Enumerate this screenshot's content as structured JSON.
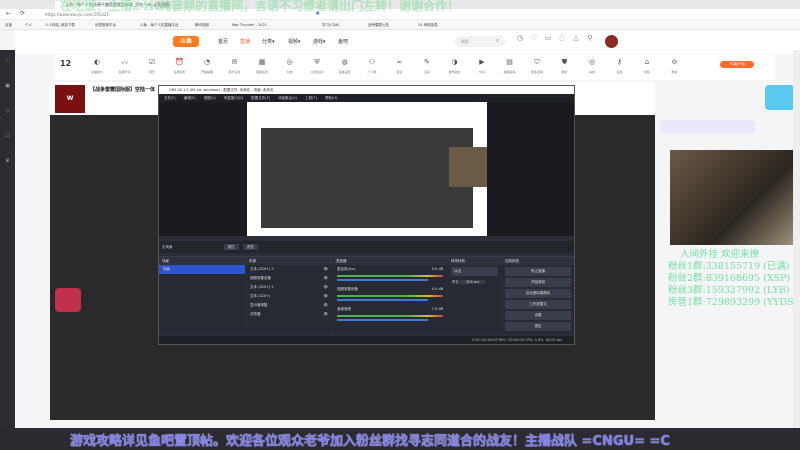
{
  "browser": {
    "tabs": [
      "斗鱼 - 每个人的直播平台",
      "战争雷霆国际服_空陆一体_斗鱼直播"
    ],
    "url": "https://www.douyu.com/201321",
    "bookmarks": [
      "百度",
      "个人",
      "人人网站_网游下载",
      "优秀推荐平台",
      "斗鱼 - 每个人的直播平台",
      "腾讯视频",
      "War Thunder - 2021",
      "学习(CDN)",
      "战争雷霆公告",
      "24 网络信息"
    ]
  },
  "overlay_top": "在吃饭：主播24K纯音频的直播间，言语不习惯者请出门左转！谢谢合作！",
  "site": {
    "logo": "斗鱼",
    "nav": [
      "首页",
      "直播",
      "分类▾",
      "视频▾",
      "游戏▾",
      "鱼吧"
    ],
    "search_placeholder": "搜索",
    "header_icons": [
      "历史",
      "关注",
      "下载",
      "客户端",
      "消息",
      "创作中心"
    ],
    "sidebar": [
      "推荐",
      "关注",
      "游戏",
      "娱乐",
      "更多"
    ],
    "toolbar": {
      "level": "12",
      "items": [
        "主播积分",
        "直播开关",
        "音乐",
        "主播任务",
        "开播提醒",
        "用户任务",
        "宝箱任务",
        "礼物",
        "礼物活动",
        "直播设置",
        "小飞机",
        "连麦",
        "互动",
        "发布动态",
        "分享",
        "视频投稿",
        "更多活动",
        "超管",
        "禁言",
        "设置",
        "隐私",
        "粉丝",
        "更多"
      ],
      "pc_button": "PC客户端"
    },
    "room_title": "【战争雷霆国际服】空陆一体",
    "room_avatar": "WAR THUNDER"
  },
  "obs": {
    "title": "OBS 28.1.1 (64 bit, windows) - 配置文件: 未命名 - 场景: 未命名",
    "menu": [
      "文件(F)",
      "编辑(E)",
      "视图(V)",
      "停靠窗口(D)",
      "配置文件(P)",
      "场景集合(S)",
      "工具(T)",
      "帮助(H)"
    ],
    "scene_bar": [
      "无场景",
      "属性",
      "滤镜"
    ],
    "panels": {
      "scenes": {
        "title": "场景",
        "items": [
          "场景"
        ]
      },
      "sources": {
        "title": "来源",
        "items": [
          "文本 (GDI+) 3",
          "视频采集设备",
          "文本 (GDI+) 2",
          "文本 (GDI+)",
          "显示器采集",
          "浏览器"
        ]
      },
      "mixer": {
        "title": "混音器",
        "items": [
          {
            "name": "麦克风/Aux",
            "db": "0.0 dB"
          },
          {
            "name": "视频采集设备",
            "db": "0.0 dB"
          },
          {
            "name": "桌面音频",
            "db": "-7.0 dB"
          }
        ]
      },
      "transitions": {
        "title": "转场特效",
        "type": "淡出",
        "duration_label": "时长",
        "duration": "300 ms"
      },
      "controls": {
        "title": "控制按钮",
        "items": [
          "停止直播",
          "开始录制",
          "启动虚拟摄像机",
          "工作室模式",
          "设置",
          "退出"
        ]
      }
    },
    "status": "LIVE: 00:00:00   REC: 00:00:00   CPU: 0.4%, 60.00 fps"
  },
  "right_overlay": [
    "人间外挂 欢迎来撩",
    "粉丝1群:338155719 (已满)",
    "粉丝2群:839168695 (XSP)",
    "粉丝3群:159327992 (LYB)",
    "房管1群:729893299 (YYDS)"
  ],
  "marquee": "游戏攻略详见鱼吧置顶帖。欢迎各位观众老爷加入粉丝群找寻志同道合的战友！主播战队 =CNGU= =C"
}
